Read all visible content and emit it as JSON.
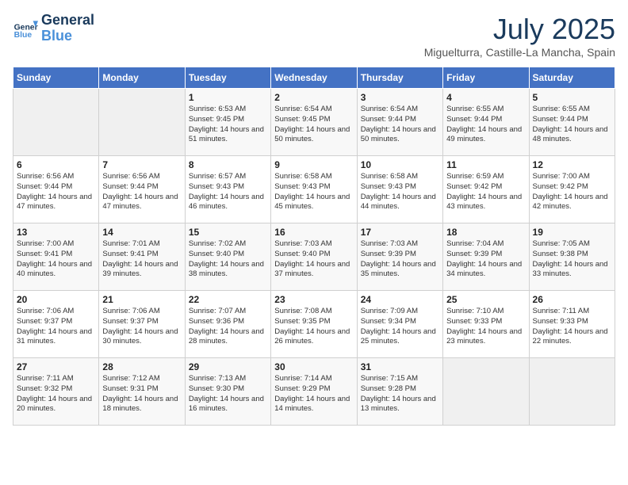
{
  "header": {
    "logo_line1": "General",
    "logo_line2": "Blue",
    "month_title": "July 2025",
    "location": "Miguelturra, Castille-La Mancha, Spain"
  },
  "weekdays": [
    "Sunday",
    "Monday",
    "Tuesday",
    "Wednesday",
    "Thursday",
    "Friday",
    "Saturday"
  ],
  "weeks": [
    [
      {
        "num": "",
        "info": ""
      },
      {
        "num": "",
        "info": ""
      },
      {
        "num": "1",
        "info": "Sunrise: 6:53 AM\nSunset: 9:45 PM\nDaylight: 14 hours and 51 minutes."
      },
      {
        "num": "2",
        "info": "Sunrise: 6:54 AM\nSunset: 9:45 PM\nDaylight: 14 hours and 50 minutes."
      },
      {
        "num": "3",
        "info": "Sunrise: 6:54 AM\nSunset: 9:44 PM\nDaylight: 14 hours and 50 minutes."
      },
      {
        "num": "4",
        "info": "Sunrise: 6:55 AM\nSunset: 9:44 PM\nDaylight: 14 hours and 49 minutes."
      },
      {
        "num": "5",
        "info": "Sunrise: 6:55 AM\nSunset: 9:44 PM\nDaylight: 14 hours and 48 minutes."
      }
    ],
    [
      {
        "num": "6",
        "info": "Sunrise: 6:56 AM\nSunset: 9:44 PM\nDaylight: 14 hours and 47 minutes."
      },
      {
        "num": "7",
        "info": "Sunrise: 6:56 AM\nSunset: 9:44 PM\nDaylight: 14 hours and 47 minutes."
      },
      {
        "num": "8",
        "info": "Sunrise: 6:57 AM\nSunset: 9:43 PM\nDaylight: 14 hours and 46 minutes."
      },
      {
        "num": "9",
        "info": "Sunrise: 6:58 AM\nSunset: 9:43 PM\nDaylight: 14 hours and 45 minutes."
      },
      {
        "num": "10",
        "info": "Sunrise: 6:58 AM\nSunset: 9:43 PM\nDaylight: 14 hours and 44 minutes."
      },
      {
        "num": "11",
        "info": "Sunrise: 6:59 AM\nSunset: 9:42 PM\nDaylight: 14 hours and 43 minutes."
      },
      {
        "num": "12",
        "info": "Sunrise: 7:00 AM\nSunset: 9:42 PM\nDaylight: 14 hours and 42 minutes."
      }
    ],
    [
      {
        "num": "13",
        "info": "Sunrise: 7:00 AM\nSunset: 9:41 PM\nDaylight: 14 hours and 40 minutes."
      },
      {
        "num": "14",
        "info": "Sunrise: 7:01 AM\nSunset: 9:41 PM\nDaylight: 14 hours and 39 minutes."
      },
      {
        "num": "15",
        "info": "Sunrise: 7:02 AM\nSunset: 9:40 PM\nDaylight: 14 hours and 38 minutes."
      },
      {
        "num": "16",
        "info": "Sunrise: 7:03 AM\nSunset: 9:40 PM\nDaylight: 14 hours and 37 minutes."
      },
      {
        "num": "17",
        "info": "Sunrise: 7:03 AM\nSunset: 9:39 PM\nDaylight: 14 hours and 35 minutes."
      },
      {
        "num": "18",
        "info": "Sunrise: 7:04 AM\nSunset: 9:39 PM\nDaylight: 14 hours and 34 minutes."
      },
      {
        "num": "19",
        "info": "Sunrise: 7:05 AM\nSunset: 9:38 PM\nDaylight: 14 hours and 33 minutes."
      }
    ],
    [
      {
        "num": "20",
        "info": "Sunrise: 7:06 AM\nSunset: 9:37 PM\nDaylight: 14 hours and 31 minutes."
      },
      {
        "num": "21",
        "info": "Sunrise: 7:06 AM\nSunset: 9:37 PM\nDaylight: 14 hours and 30 minutes."
      },
      {
        "num": "22",
        "info": "Sunrise: 7:07 AM\nSunset: 9:36 PM\nDaylight: 14 hours and 28 minutes."
      },
      {
        "num": "23",
        "info": "Sunrise: 7:08 AM\nSunset: 9:35 PM\nDaylight: 14 hours and 26 minutes."
      },
      {
        "num": "24",
        "info": "Sunrise: 7:09 AM\nSunset: 9:34 PM\nDaylight: 14 hours and 25 minutes."
      },
      {
        "num": "25",
        "info": "Sunrise: 7:10 AM\nSunset: 9:33 PM\nDaylight: 14 hours and 23 minutes."
      },
      {
        "num": "26",
        "info": "Sunrise: 7:11 AM\nSunset: 9:33 PM\nDaylight: 14 hours and 22 minutes."
      }
    ],
    [
      {
        "num": "27",
        "info": "Sunrise: 7:11 AM\nSunset: 9:32 PM\nDaylight: 14 hours and 20 minutes."
      },
      {
        "num": "28",
        "info": "Sunrise: 7:12 AM\nSunset: 9:31 PM\nDaylight: 14 hours and 18 minutes."
      },
      {
        "num": "29",
        "info": "Sunrise: 7:13 AM\nSunset: 9:30 PM\nDaylight: 14 hours and 16 minutes."
      },
      {
        "num": "30",
        "info": "Sunrise: 7:14 AM\nSunset: 9:29 PM\nDaylight: 14 hours and 14 minutes."
      },
      {
        "num": "31",
        "info": "Sunrise: 7:15 AM\nSunset: 9:28 PM\nDaylight: 14 hours and 13 minutes."
      },
      {
        "num": "",
        "info": ""
      },
      {
        "num": "",
        "info": ""
      }
    ]
  ]
}
